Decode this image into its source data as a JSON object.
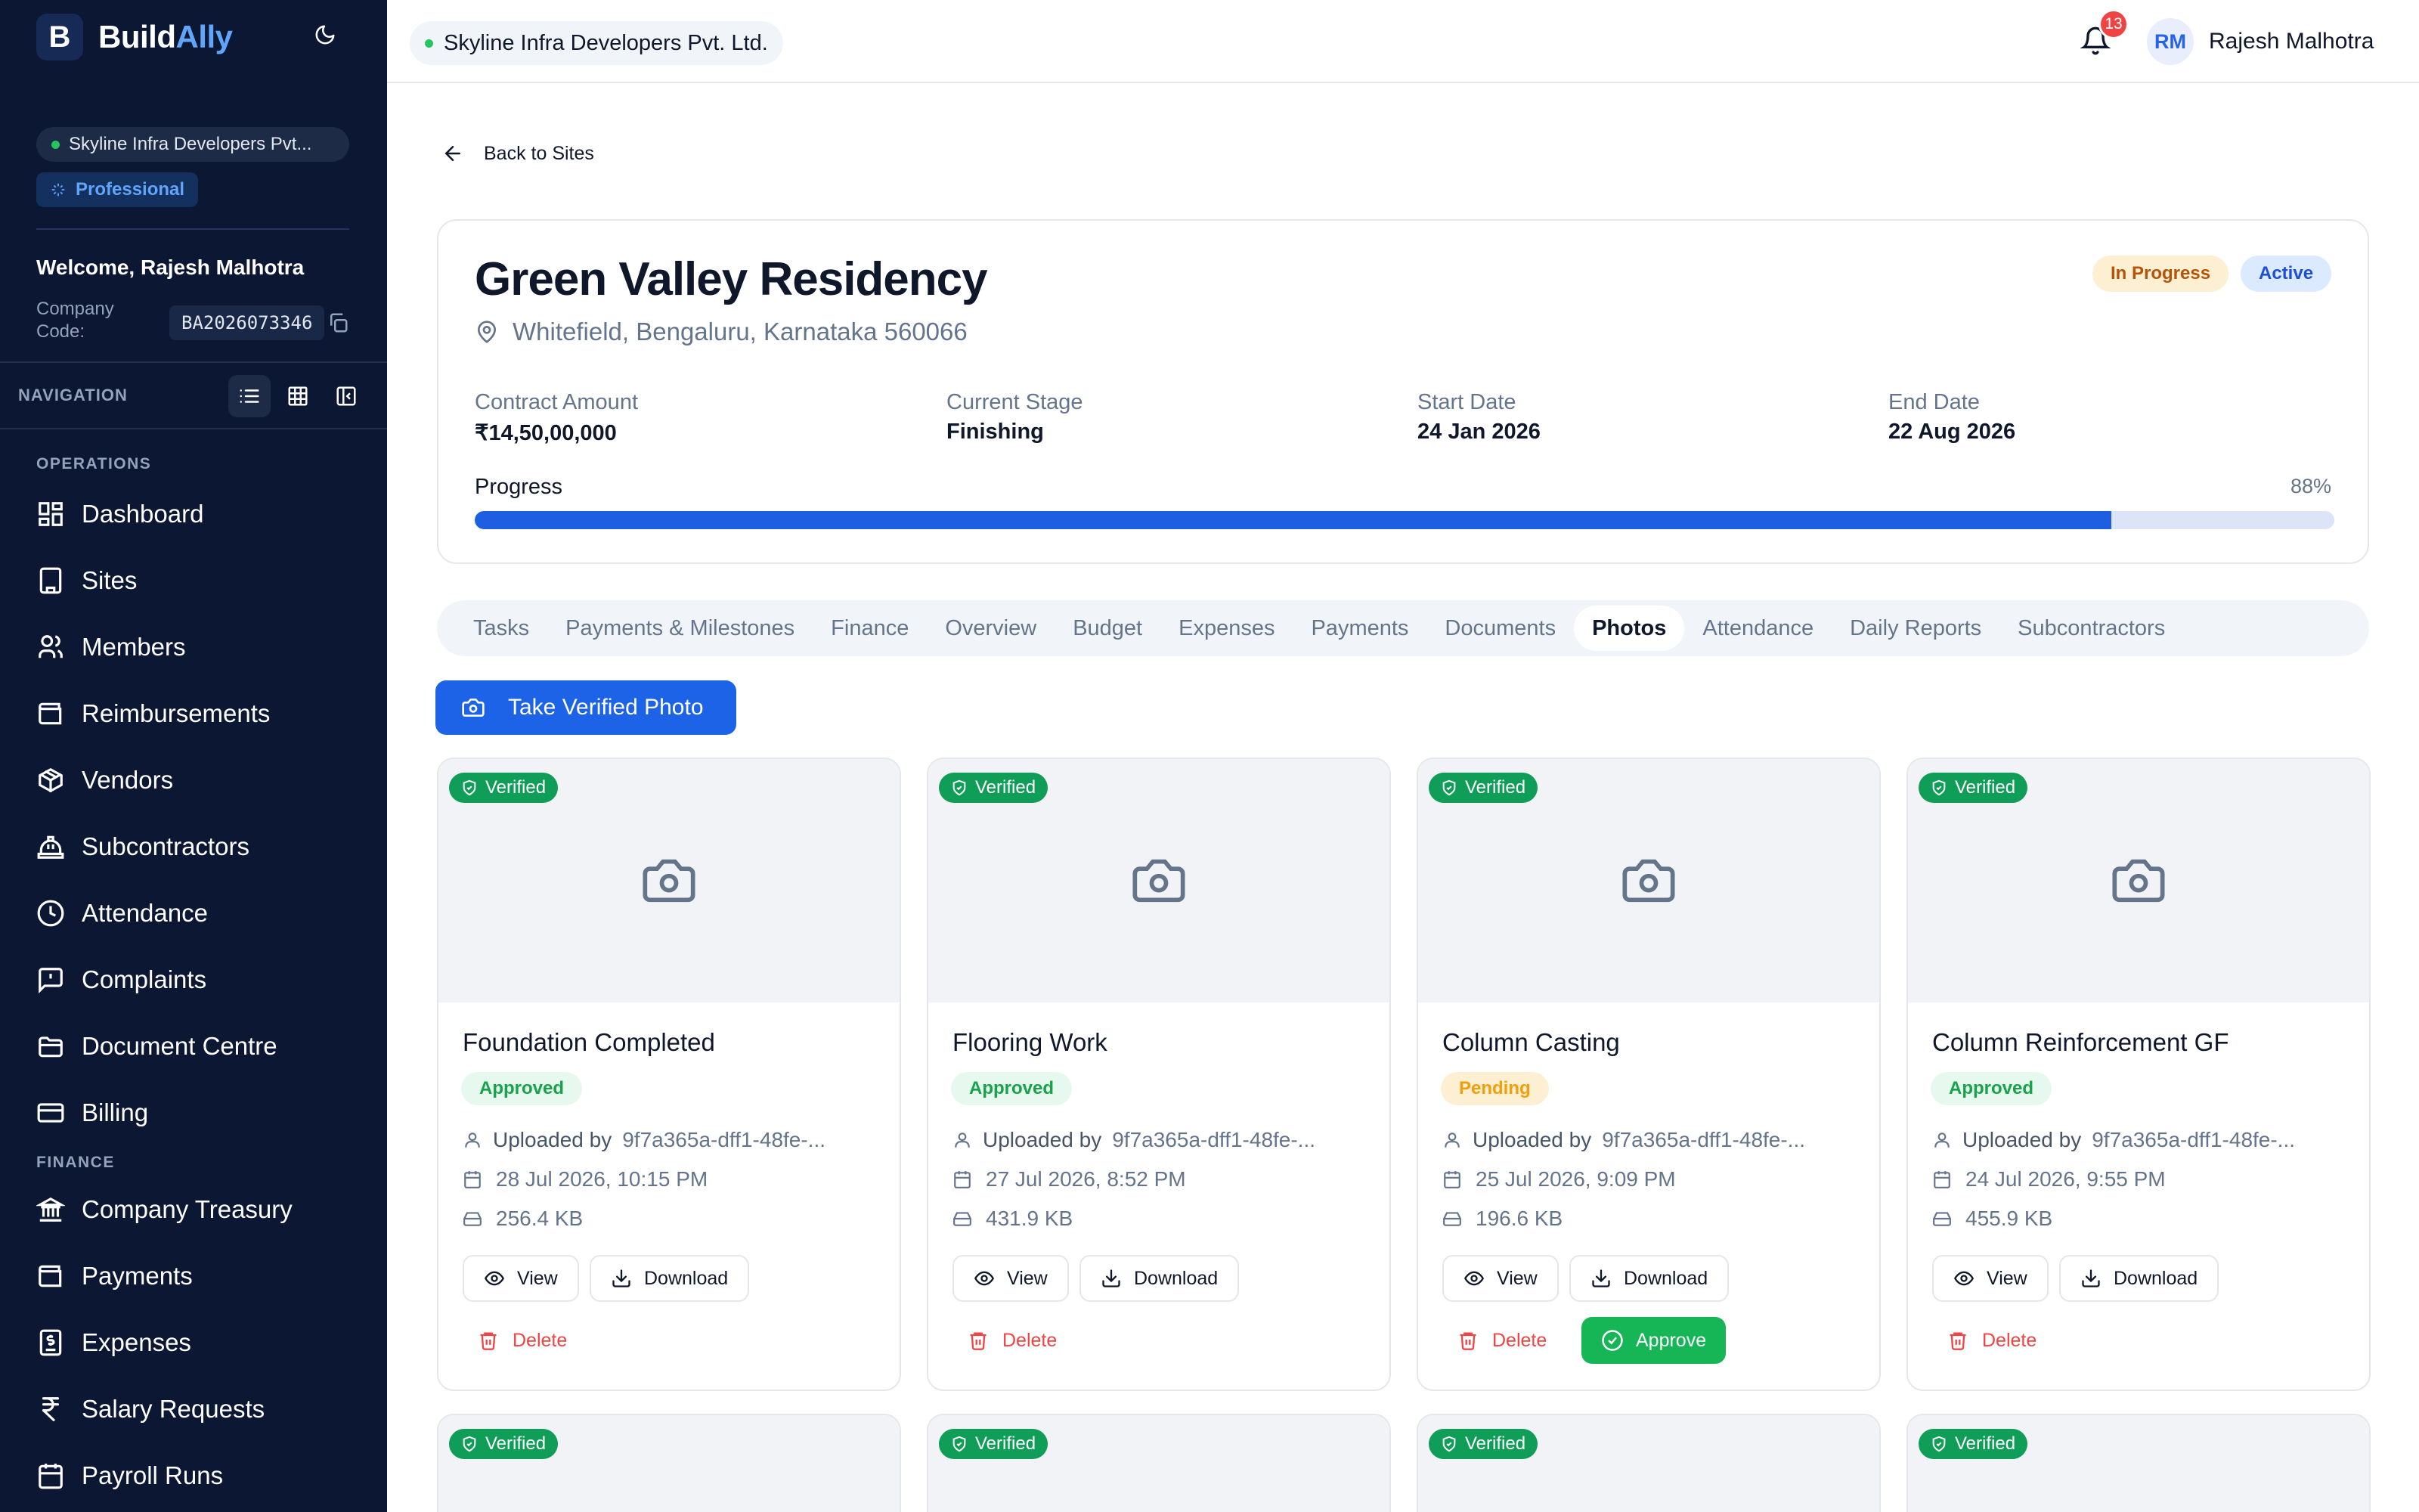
{
  "sidebar": {
    "brand_initial": "B",
    "brand_name_a": "Build",
    "brand_name_b": "Ally",
    "org_name": "Skyline Infra Developers Pvt...",
    "plan": "Professional",
    "welcome": "Welcome, Rajesh Malhotra",
    "company_code_label": "Company Code:",
    "company_code": "BA2026073346",
    "nav_label": "NAVIGATION",
    "operations_label": "OPERATIONS",
    "operations": [
      {
        "label": "Dashboard",
        "icon": "dashboard-icon"
      },
      {
        "label": "Sites",
        "icon": "building-icon"
      },
      {
        "label": "Members",
        "icon": "users-icon"
      },
      {
        "label": "Reimbursements",
        "icon": "wallet-icon"
      },
      {
        "label": "Vendors",
        "icon": "package-icon"
      },
      {
        "label": "Subcontractors",
        "icon": "hardhat-icon"
      },
      {
        "label": "Attendance",
        "icon": "clock-icon"
      },
      {
        "label": "Complaints",
        "icon": "message-alert-icon"
      },
      {
        "label": "Document Centre",
        "icon": "folder-icon"
      },
      {
        "label": "Billing",
        "icon": "credit-card-icon"
      }
    ],
    "finance_label": "FINANCE",
    "finance": [
      {
        "label": "Company Treasury",
        "icon": "bank-icon"
      },
      {
        "label": "Payments",
        "icon": "wallet-icon"
      },
      {
        "label": "Expenses",
        "icon": "receipt-icon"
      },
      {
        "label": "Salary Requests",
        "icon": "rupee-icon"
      },
      {
        "label": "Payroll Runs",
        "icon": "calendar-icon"
      }
    ]
  },
  "topbar": {
    "org_name": "Skyline Infra Developers Pvt. Ltd.",
    "notification_count": "13",
    "user_initials": "RM",
    "user_name": "Rajesh Malhotra"
  },
  "page": {
    "back_label": "Back to Sites",
    "site_title": "Green Valley Residency",
    "site_location": "Whitefield, Bengaluru, Karnataka 560066",
    "status_badge": "In Progress",
    "active_badge": "Active",
    "stats": [
      {
        "label": "Contract Amount",
        "value": "₹14,50,00,000"
      },
      {
        "label": "Current Stage",
        "value": "Finishing"
      },
      {
        "label": "Start Date",
        "value": "24 Jan 2026"
      },
      {
        "label": "End Date",
        "value": "22 Aug 2026"
      }
    ],
    "progress_label": "Progress",
    "progress_text": "88%",
    "progress_value": 88,
    "tabs": [
      "Tasks",
      "Payments & Milestones",
      "Finance",
      "Overview",
      "Budget",
      "Expenses",
      "Payments",
      "Documents",
      "Photos",
      "Attendance",
      "Daily Reports",
      "Subcontractors"
    ],
    "active_tab": "Photos",
    "take_photo_label": "Take Verified Photo"
  },
  "photos": [
    {
      "verified": "Verified",
      "title": "Foundation Completed",
      "status": "Approved",
      "uploaded_prefix": "Uploaded by",
      "uploaded_by": "9f7a365a-dff1-48fe-...",
      "date": "28 Jul 2026, 10:15 PM",
      "size": "256.4 KB",
      "view": "View",
      "download": "Download",
      "delete": "Delete"
    },
    {
      "verified": "Verified",
      "title": "Flooring Work",
      "status": "Approved",
      "uploaded_prefix": "Uploaded by",
      "uploaded_by": "9f7a365a-dff1-48fe-...",
      "date": "27 Jul 2026, 8:52 PM",
      "size": "431.9 KB",
      "view": "View",
      "download": "Download",
      "delete": "Delete"
    },
    {
      "verified": "Verified",
      "title": "Column Casting",
      "status": "Pending",
      "uploaded_prefix": "Uploaded by",
      "uploaded_by": "9f7a365a-dff1-48fe-...",
      "date": "25 Jul 2026, 9:09 PM",
      "size": "196.6 KB",
      "view": "View",
      "download": "Download",
      "delete": "Delete",
      "approve": "Approve"
    },
    {
      "verified": "Verified",
      "title": "Column Reinforcement GF",
      "status": "Approved",
      "uploaded_prefix": "Uploaded by",
      "uploaded_by": "9f7a365a-dff1-48fe-...",
      "date": "24 Jul 2026, 9:55 PM",
      "size": "455.9 KB",
      "view": "View",
      "download": "Download",
      "delete": "Delete"
    }
  ],
  "photos_row2": [
    {
      "verified": "Verified"
    },
    {
      "verified": "Verified"
    },
    {
      "verified": "Verified"
    },
    {
      "verified": "Verified"
    }
  ],
  "colors": {
    "sidebar_bg": "#0b1733",
    "primary": "#1d63e8",
    "success": "#0f9d58",
    "danger": "#ef4444"
  }
}
